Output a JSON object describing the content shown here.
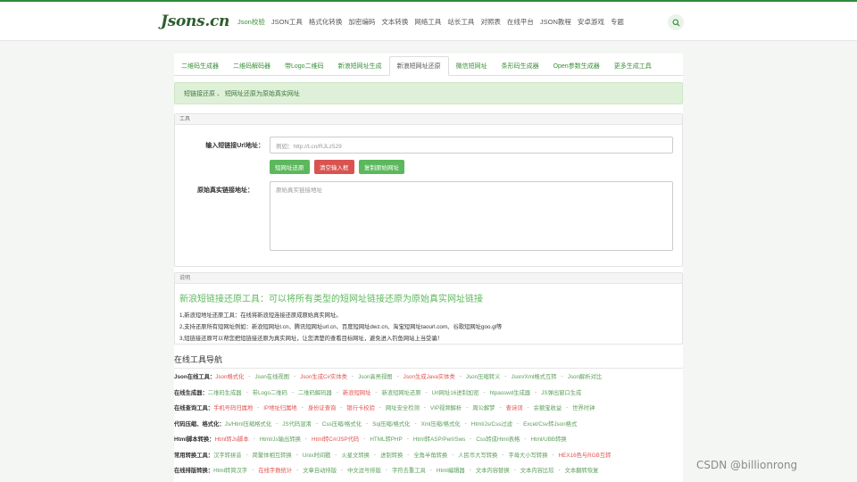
{
  "header": {
    "logo": "Jsons.cn",
    "nav": [
      "Json校验",
      "JSON工具",
      "格式化转换",
      "加密编码",
      "文本转换",
      "网络工具",
      "站长工具",
      "对照表",
      "在线平台",
      "JSON教程",
      "安卓游戏",
      "专题"
    ]
  },
  "tabs": [
    "二维码生成器",
    "二维码解码器",
    "带Logo二维码",
    "新浪短网址生成",
    "新浪短网址还原",
    "微信短网址",
    "条形码生成器",
    "Open参数生成器",
    "更多生成工具"
  ],
  "alert": "短链接还原 、 短网址还原为原始真实网址",
  "tool": {
    "head": "工具",
    "input_label": "输入短链接Url地址：",
    "input_placeholder": "例如：http://t.cn/RJLz529",
    "btn_restore": "短网址还原",
    "btn_clear": "清空输入框",
    "btn_copy": "复制原始网址",
    "result_label": "原始真实链接地址：",
    "result_placeholder": "原始真实链接地址"
  },
  "desc": {
    "head": "说明",
    "title": "新浪短链接还原工具：可以将所有类型的短网址链接还原为原始真实网址链接",
    "lines": [
      "1,新浪短地址还原工具：在线将新浪短连接还原成原始真实网址。",
      "2,支持还原所有短网址例如：新浪短网址t.cn、腾讯短网址url.cn、百度短网址dwz.cn、淘宝短网址taourl.com、谷歌短网址goo.gl等",
      "3,短链接还原可以帮您把短链接还原为真实网址，让您清楚的查看目标网址，避免进入钓鱼网站上当受骗！"
    ]
  },
  "tool_nav": {
    "title": "在线工具导航",
    "rows": [
      {
        "label": "Json在线工具：",
        "links": [
          "Json格式化",
          "Json在线视图",
          "Json生成C#实体类",
          "Json高亮视图",
          "Json生成Java实体类",
          "Json压缩转义",
          "Json/Xml格式互转",
          "Json解析对比"
        ],
        "red": [
          0,
          2,
          4
        ]
      },
      {
        "label": "在线生成器：",
        "links": [
          "二维码生成器",
          "带Logo二维码",
          "二维码解码器",
          "新浪短网址",
          "新浪短网址还原",
          "Url网址16进制加密",
          "htpasswd生成器",
          "JS弹出窗口生成"
        ],
        "red": [
          3
        ]
      },
      {
        "label": "在线查询工具：",
        "links": [
          "手机号码归属地",
          "IP地址归属地",
          "身份证查询",
          "银行卡校验",
          "网址安全检测",
          "VIP视频解析",
          "周公解梦",
          "查诗词",
          "余额宝收益",
          "世界时钟"
        ],
        "red": [
          0,
          1,
          2,
          3,
          7
        ]
      },
      {
        "label": "代码压缩、格式化：",
        "links": [
          "Js/Html压缩格式化",
          "JS代码混淆",
          "Css压缩/格式化",
          "Sql压缩/格式化",
          "Xml压缩/格式化",
          "Html/Js/Css过滤",
          "Excel/Csv转Json格式"
        ],
        "red": []
      },
      {
        "label": "Html脚本转换：",
        "links": [
          "Html转Js脚本",
          "Html/Js输出转换",
          "Html转C#/JSP代码",
          "HTML转PHP",
          "Html转ASP/Perl/Sws",
          "Css转成Html表格",
          "Html/UBB转换"
        ],
        "red": [
          0,
          2
        ]
      },
      {
        "label": "常用转换工具：",
        "links": [
          "汉字转拼音",
          "简繁体相互转换",
          "Unix时间戳",
          "火星文转换",
          "进制转换",
          "全角半角转换",
          "人民币大写转换",
          "字母大小写转换",
          "HEX16色与RGB互转"
        ],
        "red": [
          8
        ]
      },
      {
        "label": "在线排版转换：",
        "links": [
          "Html转简汉字",
          "在线字数统计",
          "文章自动排版",
          "中文逗号排版",
          "字符去重工具",
          "Html编辑器",
          "文本内容替换",
          "文本内容比较",
          "文本翻转恢复"
        ],
        "red": [
          1
        ]
      }
    ]
  },
  "watermark": "CSDN @billionrong",
  "colors": {
    "brand": "#2e8b3b",
    "link": "#5a9e5a",
    "danger": "#d9534f",
    "success_bg": "#dff0d8"
  }
}
